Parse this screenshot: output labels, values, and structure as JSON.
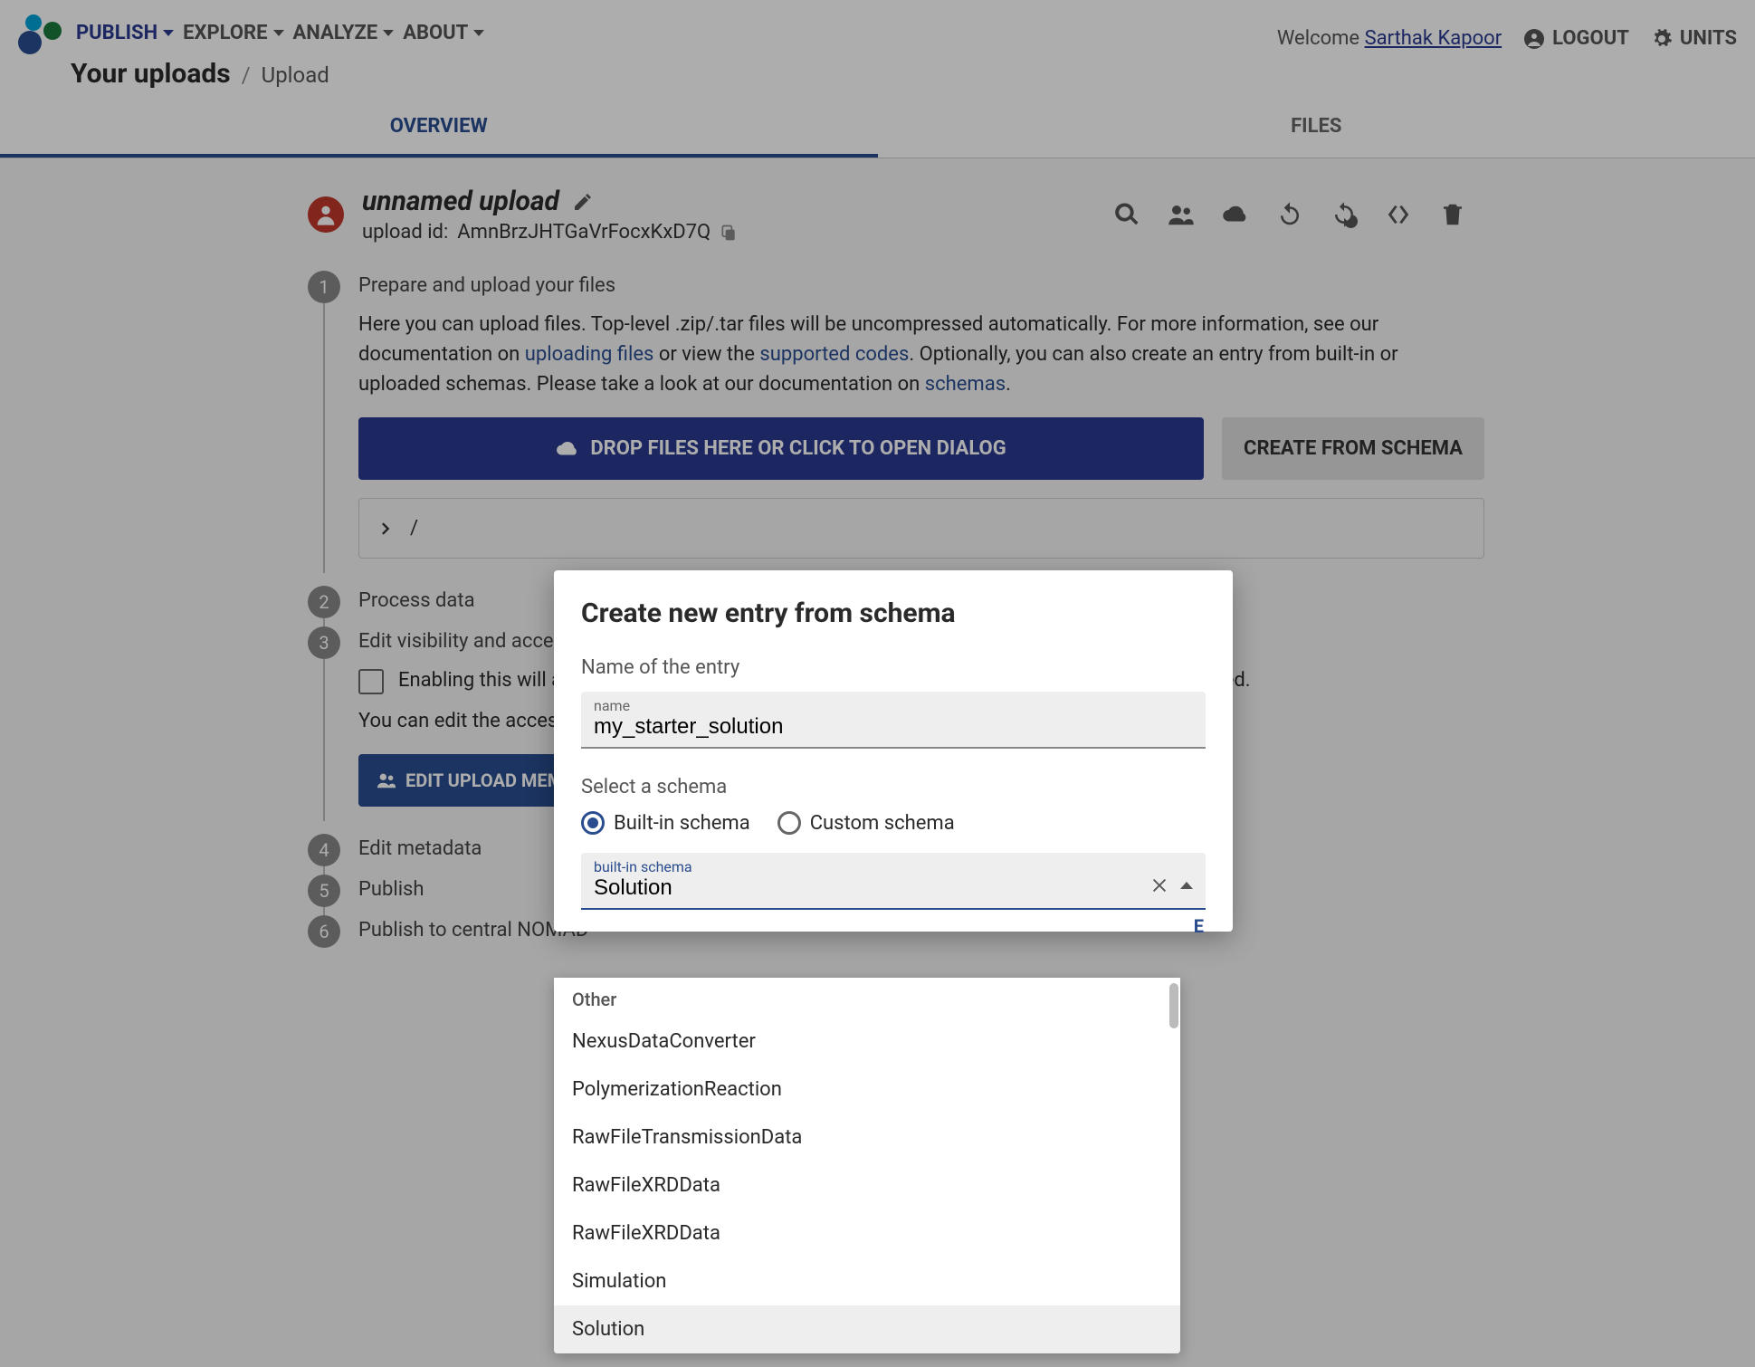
{
  "nav": {
    "publish": "PUBLISH",
    "explore": "EXPLORE",
    "analyze": "ANALYZE",
    "about": "ABOUT"
  },
  "breadcrumb": {
    "main": "Your uploads",
    "sep": "/",
    "current": "Upload"
  },
  "hdr": {
    "welcome": "Welcome ",
    "user": "Sarthak Kapoor",
    "logout": "LOGOUT",
    "units": "UNITS"
  },
  "tabs": {
    "overview": "OVERVIEW",
    "files": "FILES"
  },
  "upload": {
    "title": "unnamed upload",
    "id_label": "upload id: ",
    "id": "AmnBrzJHTGaVrFocxKxD7Q"
  },
  "steps": {
    "s1": {
      "num": "1",
      "title": "Prepare and upload your files",
      "body1": "Here you can upload files. Top-level .zip/.tar files will be uncompressed automatically. For more information, see our documentation on ",
      "link1": "uploading files",
      "body2": " or view the ",
      "link2": "supported codes",
      "body3": ". Optionally, you can also create an entry from built-in or uploaded schemas. Please take a look at our documentation on ",
      "link3": "schemas",
      "body4": ".",
      "drop": "DROP FILES HERE OR CLICK TO OPEN DIALOG",
      "create": "CREATE FROM SCHEMA",
      "path": "/"
    },
    "s2": {
      "num": "2",
      "title": "Process data"
    },
    "s3": {
      "num": "3",
      "title": "Edit visibility and access",
      "check": "Enabling this will allow you to share your upload with others via a link, even before it is published.",
      "note": "You can edit the access permissions of members here.",
      "btn": "EDIT UPLOAD MEMBERS"
    },
    "s4": {
      "num": "4",
      "title": "Edit metadata"
    },
    "s5": {
      "num": "5",
      "title": "Publish"
    },
    "s6": {
      "num": "6",
      "title": "Publish to central NOMAD"
    }
  },
  "dialog": {
    "title": "Create new entry from schema",
    "name_label": "Name of the entry",
    "name_field": "name",
    "name_value": "my_starter_solution",
    "select_label": "Select a schema",
    "radio1": "Built-in schema",
    "radio2": "Custom schema",
    "combo_label": "built-in schema",
    "combo_value": "Solution",
    "action": "E"
  },
  "dropdown": {
    "group": "Other",
    "items": [
      "NexusDataConverter",
      "PolymerizationReaction",
      "RawFileTransmissionData",
      "RawFileXRDData",
      "RawFileXRDData",
      "Simulation",
      "Solution"
    ]
  }
}
